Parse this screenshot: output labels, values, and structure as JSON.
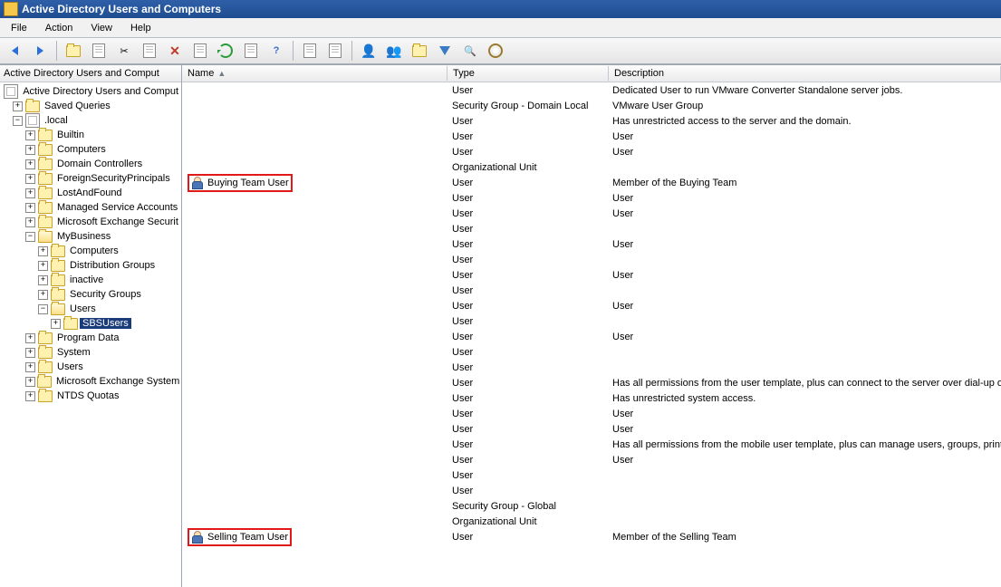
{
  "window": {
    "title": "Active Directory Users and Computers"
  },
  "menu": {
    "file": "File",
    "action": "Action",
    "view": "View",
    "help": "Help"
  },
  "tree_header": "Active Directory Users and Comput",
  "list_headers": {
    "name": "Name",
    "type": "Type",
    "description": "Description"
  },
  "tree": [
    {
      "indent": 0,
      "exp": "none",
      "icon": "root",
      "label": "Active Directory Users and Comput"
    },
    {
      "indent": 1,
      "exp": "plus",
      "icon": "sfolder",
      "label": "Saved Queries"
    },
    {
      "indent": 1,
      "exp": "minus",
      "icon": "domain",
      "label": ".local"
    },
    {
      "indent": 2,
      "exp": "plus",
      "icon": "folder",
      "label": "Builtin"
    },
    {
      "indent": 2,
      "exp": "plus",
      "icon": "folder",
      "label": "Computers"
    },
    {
      "indent": 2,
      "exp": "plus",
      "icon": "folder",
      "label": "Domain Controllers"
    },
    {
      "indent": 2,
      "exp": "plus",
      "icon": "folder",
      "label": "ForeignSecurityPrincipals"
    },
    {
      "indent": 2,
      "exp": "plus",
      "icon": "folder",
      "label": "LostAndFound"
    },
    {
      "indent": 2,
      "exp": "plus",
      "icon": "folder",
      "label": "Managed Service Accounts"
    },
    {
      "indent": 2,
      "exp": "plus",
      "icon": "folder",
      "label": "Microsoft Exchange Securit"
    },
    {
      "indent": 2,
      "exp": "minus",
      "icon": "folder",
      "label": "MyBusiness"
    },
    {
      "indent": 3,
      "exp": "plus",
      "icon": "folder",
      "label": "Computers"
    },
    {
      "indent": 3,
      "exp": "plus",
      "icon": "folder",
      "label": "Distribution Groups"
    },
    {
      "indent": 3,
      "exp": "plus",
      "icon": "folder",
      "label": "inactive"
    },
    {
      "indent": 3,
      "exp": "plus",
      "icon": "folder",
      "label": "Security Groups"
    },
    {
      "indent": 3,
      "exp": "minus",
      "icon": "folder",
      "label": "Users"
    },
    {
      "indent": 4,
      "exp": "plus",
      "icon": "folder",
      "label": "SBSUsers",
      "selected": true
    },
    {
      "indent": 2,
      "exp": "plus",
      "icon": "folder",
      "label": "Program Data"
    },
    {
      "indent": 2,
      "exp": "plus",
      "icon": "folder",
      "label": "System"
    },
    {
      "indent": 2,
      "exp": "plus",
      "icon": "folder",
      "label": "Users"
    },
    {
      "indent": 2,
      "exp": "plus",
      "icon": "folder",
      "label": "Microsoft Exchange System"
    },
    {
      "indent": 2,
      "exp": "plus",
      "icon": "folder",
      "label": "NTDS Quotas"
    }
  ],
  "rows": [
    {
      "name": "",
      "type": "User",
      "desc": "Dedicated User to run VMware Converter Standalone server jobs."
    },
    {
      "name": "",
      "type": "Security Group - Domain Local",
      "desc": "VMware User Group"
    },
    {
      "name": "",
      "type": "User",
      "desc": "Has unrestricted access to the server and the domain."
    },
    {
      "name": "",
      "type": "User",
      "desc": "User"
    },
    {
      "name": "",
      "type": "User",
      "desc": "User"
    },
    {
      "name": "",
      "type": "Organizational Unit",
      "desc": ""
    },
    {
      "name": "Buying Team User",
      "type": "User",
      "desc": "Member of the Buying Team",
      "highlight": true
    },
    {
      "name": "",
      "type": "User",
      "desc": "User"
    },
    {
      "name": "",
      "type": "User",
      "desc": "User"
    },
    {
      "name": "",
      "type": "User",
      "desc": ""
    },
    {
      "name": "",
      "type": "User",
      "desc": "User"
    },
    {
      "name": "",
      "type": "User",
      "desc": ""
    },
    {
      "name": "",
      "type": "User",
      "desc": "User"
    },
    {
      "name": "",
      "type": "User",
      "desc": ""
    },
    {
      "name": "",
      "type": "User",
      "desc": "User"
    },
    {
      "name": "",
      "type": "User",
      "desc": ""
    },
    {
      "name": "",
      "type": "User",
      "desc": "User"
    },
    {
      "name": "",
      "type": "User",
      "desc": ""
    },
    {
      "name": "",
      "type": "User",
      "desc": ""
    },
    {
      "name": "",
      "type": "User",
      "desc": "Has all permissions from the user template, plus can connect to the server over dial-up or VP"
    },
    {
      "name": "",
      "type": "User",
      "desc": "Has unrestricted system access."
    },
    {
      "name": "",
      "type": "User",
      "desc": "User"
    },
    {
      "name": "",
      "type": "User",
      "desc": "User"
    },
    {
      "name": "",
      "type": "User",
      "desc": "Has all permissions from the mobile user template, plus can manage users, groups, printers,"
    },
    {
      "name": "",
      "type": "User",
      "desc": "User"
    },
    {
      "name": "",
      "type": "User",
      "desc": ""
    },
    {
      "name": "",
      "type": "User",
      "desc": ""
    },
    {
      "name": "",
      "type": "Security Group - Global",
      "desc": ""
    },
    {
      "name": "",
      "type": "Organizational Unit",
      "desc": ""
    },
    {
      "name": "Selling Team User",
      "type": "User",
      "desc": "Member of the Selling Team",
      "highlight": true
    }
  ]
}
